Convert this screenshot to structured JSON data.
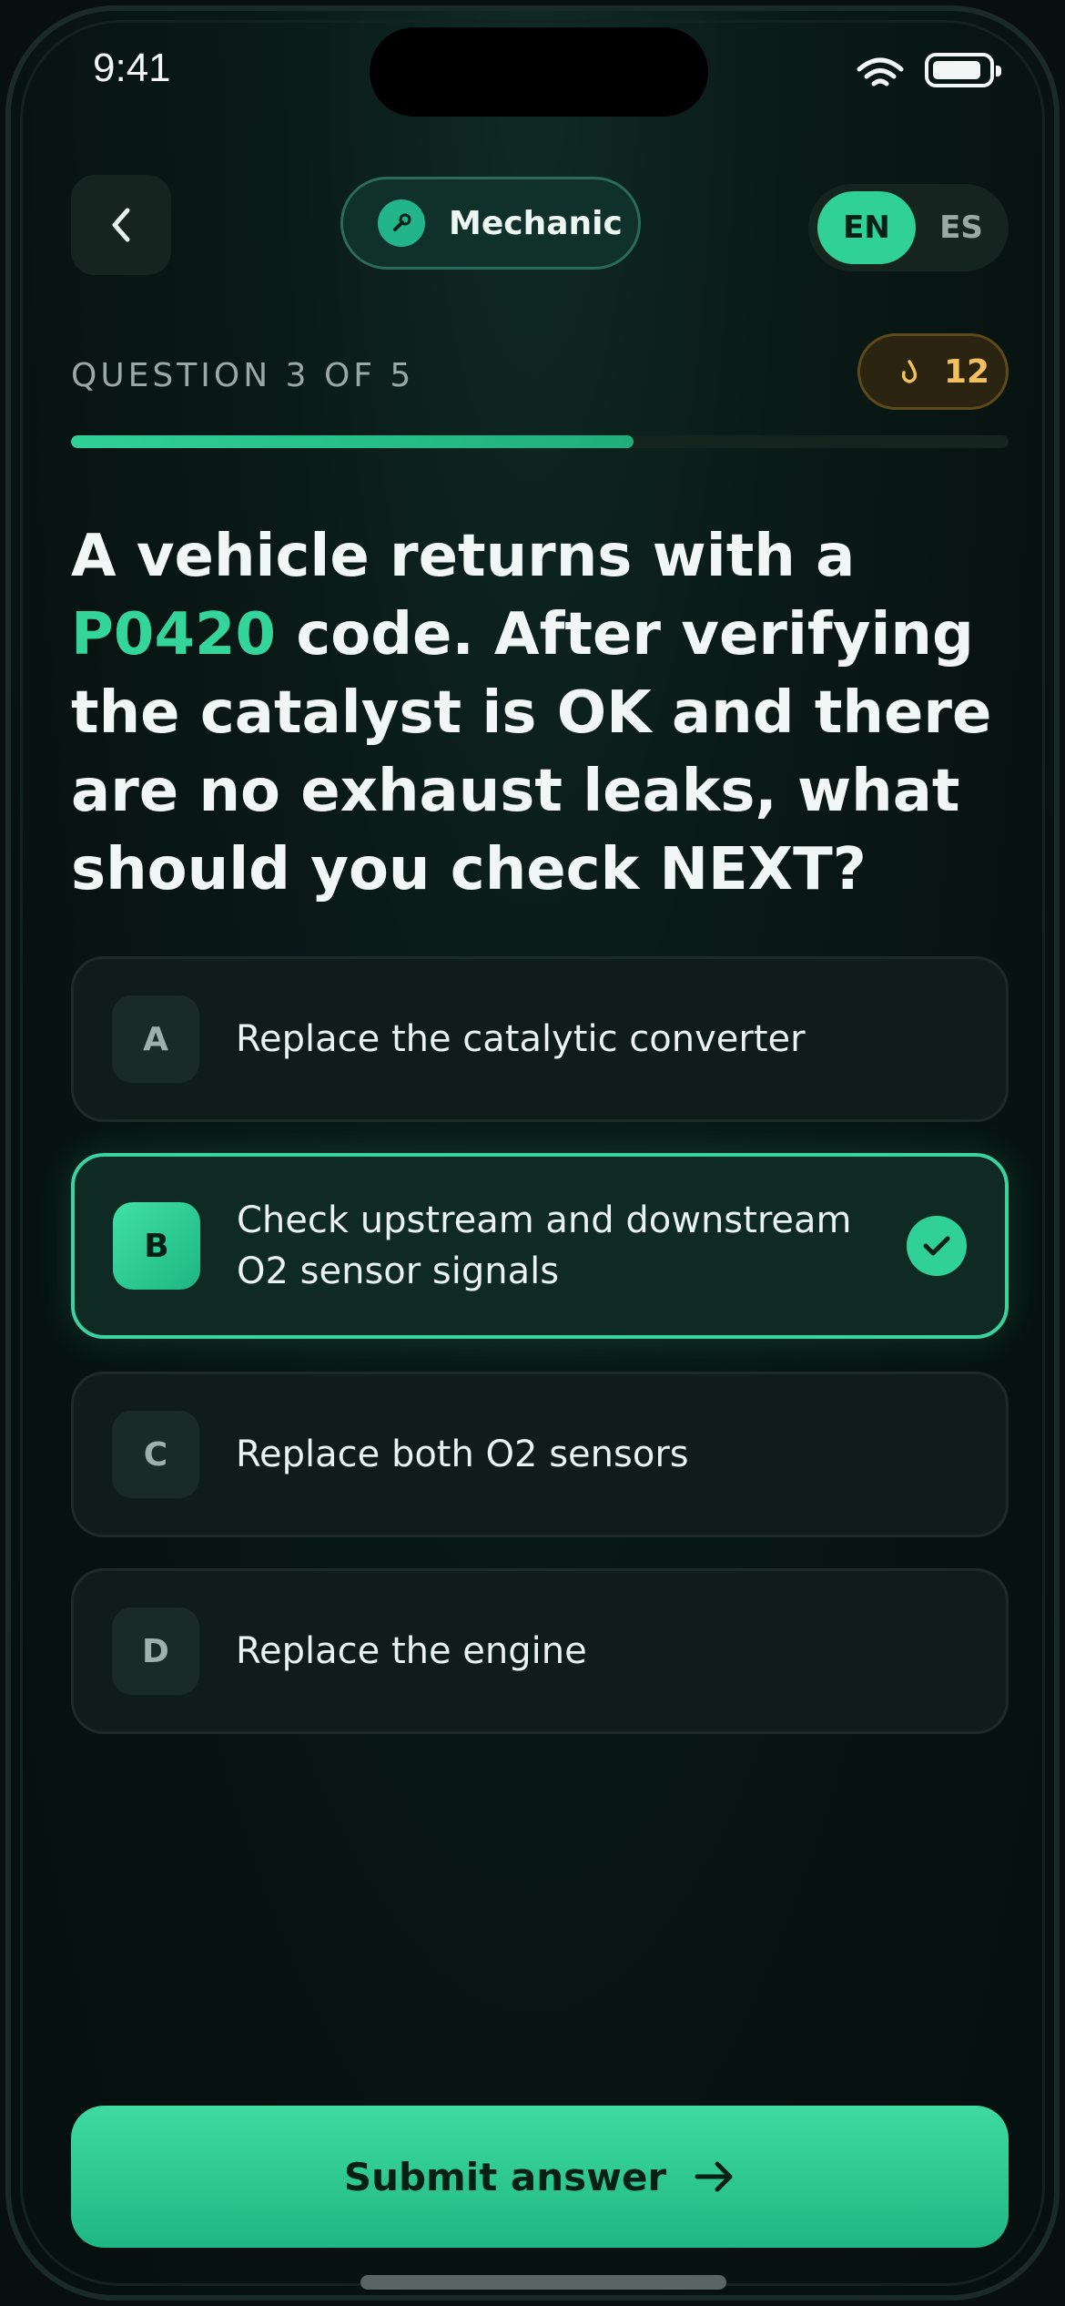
{
  "status": {
    "time": "9:41"
  },
  "header": {
    "role": "Mechanic",
    "lang_active": "EN",
    "lang_other": "ES"
  },
  "quiz": {
    "question_counter": "QUESTION 3 OF 5",
    "streak": "12",
    "progress_fraction": 0.6,
    "question_prefix": "A vehicle returns with a ",
    "question_code": "P0420",
    "question_suffix": " code. After verifying the catalyst is OK and there are no exhaust leaks, what should you check NEXT?"
  },
  "options": [
    {
      "letter": "A",
      "text": "Replace the catalytic converter",
      "selected": false
    },
    {
      "letter": "B",
      "text": "Check upstream and downstream O2 sensor signals",
      "selected": true
    },
    {
      "letter": "C",
      "text": "Replace both O2 sensors",
      "selected": false
    },
    {
      "letter": "D",
      "text": "Replace the engine",
      "selected": false
    }
  ],
  "footer": {
    "submit_label": "Submit answer"
  },
  "colors": {
    "accent": "#2fd198",
    "streak": "#f2c05c",
    "background": "#07100e"
  }
}
